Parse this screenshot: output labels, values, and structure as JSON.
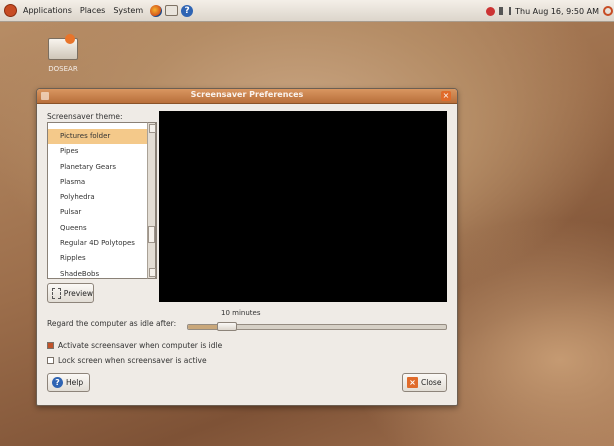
{
  "top_panel": {
    "menus": [
      "Applications",
      "Places",
      "System"
    ],
    "launchers": [
      "firefox-icon",
      "mail-icon",
      "help-icon"
    ],
    "clock": "Thu Aug 16,  9:50 AM"
  },
  "desktop": {
    "icon_label": "DOSEAR"
  },
  "dialog": {
    "title": "Screensaver Preferences",
    "theme_label": "Screensaver theme:",
    "themes": [
      "Pictures folder",
      "Pipes",
      "Planetary Gears",
      "Plasma",
      "Polyhedra",
      "Pulsar",
      "Queens",
      "Regular 4D Polytopes",
      "Ripples",
      "ShadeBobs"
    ],
    "selected_theme": "Pictures folder",
    "preview_button": "Preview",
    "idle_label": "Regard the computer as idle after:",
    "idle_value": "10 minutes",
    "idle_fraction": 0.12,
    "activate_label": "Activate screensaver when computer is idle",
    "activate_checked": true,
    "lock_label": "Lock screen when screensaver is active",
    "lock_checked": false,
    "help_button": "Help",
    "close_button": "Close",
    "accent_color": "#c0532a",
    "selection_color": "#f4c98a"
  }
}
